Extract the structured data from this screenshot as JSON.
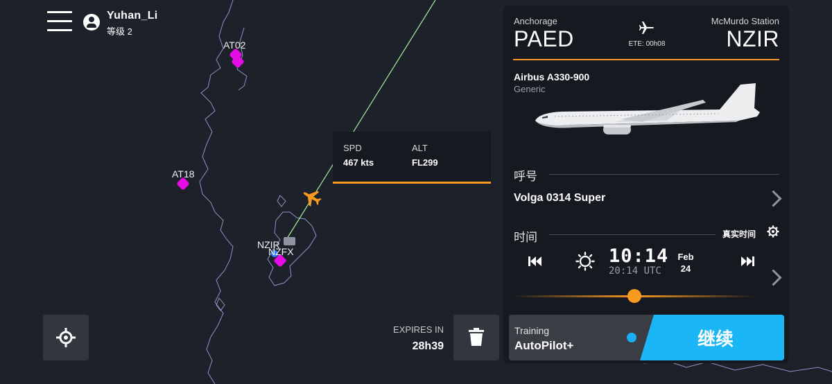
{
  "user": {
    "name": "Yuhan_Li",
    "level": "等级 2"
  },
  "map": {
    "waypoints": [
      {
        "label": "AT02"
      },
      {
        "label": "AT18"
      },
      {
        "label": "NZIR"
      },
      {
        "label": "NZFX"
      }
    ]
  },
  "flight_info": {
    "speed_label": "SPD",
    "speed_value": "467 kts",
    "alt_label": "ALT",
    "alt_value": "FL299"
  },
  "expires": {
    "label": "EXPIRES IN",
    "value": "28h39"
  },
  "route": {
    "origin_city": "Anchorage",
    "origin_code": "PAED",
    "dest_city": "McMurdo Station",
    "dest_code": "NZIR",
    "ete": "ETE: 00h08"
  },
  "aircraft": {
    "name": "Airbus A330-900",
    "livery": "Generic"
  },
  "callsign": {
    "section_title": "呼号",
    "value": "Volga 0314 Super"
  },
  "time": {
    "section_title": "时间",
    "mode_label": "真实时间",
    "local_time": "10:14",
    "utc_time": "20:14 UTC",
    "month": "Feb",
    "day": "24",
    "slider_position": 0.5
  },
  "action": {
    "mode_label": "Training",
    "mode_value": "AutoPilot+",
    "continue_label": "继续"
  },
  "colors": {
    "accent": "#f89a22",
    "go": "#1ab6f5",
    "waypoint": "#e60ce6",
    "route": "#a4f09c"
  }
}
